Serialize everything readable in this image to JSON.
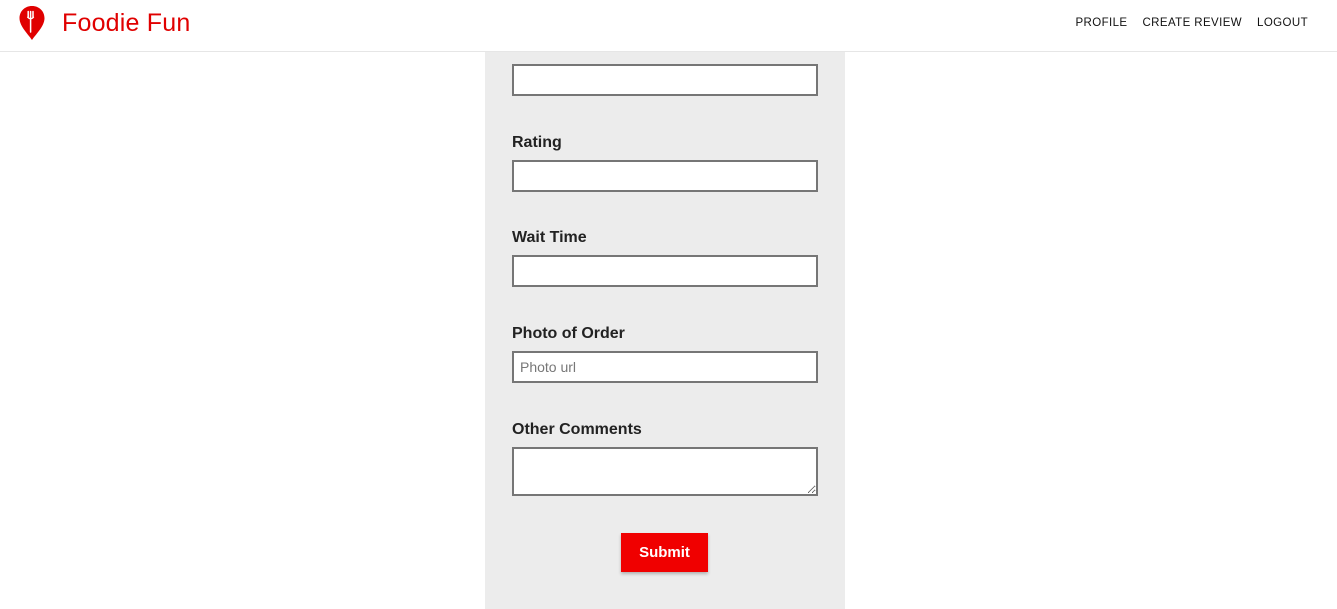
{
  "app": {
    "name": "Foodie Fun",
    "logo_icon": "map-pin-fork-icon",
    "brand_color": "#e00000"
  },
  "nav": {
    "items": [
      {
        "label": "PROFILE"
      },
      {
        "label": "CREATE REVIEW"
      },
      {
        "label": "LOGOUT"
      }
    ]
  },
  "form": {
    "fields": [
      {
        "label": "",
        "value": "",
        "placeholder": ""
      },
      {
        "label": "Rating",
        "value": "",
        "placeholder": ""
      },
      {
        "label": "Wait Time",
        "value": "",
        "placeholder": ""
      },
      {
        "label": "Photo of Order",
        "value": "",
        "placeholder": "Photo url"
      },
      {
        "label": "Other Comments",
        "value": "",
        "placeholder": ""
      }
    ],
    "submit_label": "Submit",
    "submit_color": "#f00000",
    "panel_color": "#ececec"
  }
}
